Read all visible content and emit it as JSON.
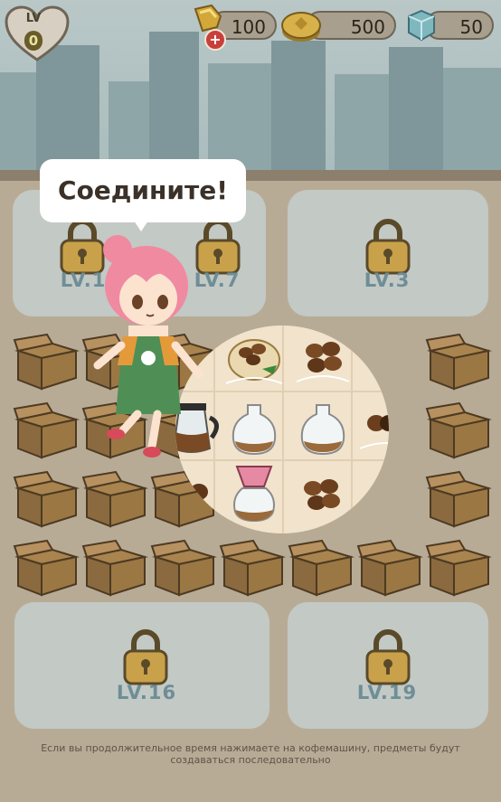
{
  "hud": {
    "level_label": "LV",
    "level_value": "0",
    "energy": "100",
    "coins": "500",
    "gems": "50",
    "icons": [
      "heart-icon",
      "energy-icon",
      "plus-icon",
      "coin-icon",
      "gem-icon"
    ]
  },
  "tutorial": {
    "bubble_text": "Соедините!"
  },
  "zones": {
    "top_left": "LV.1",
    "top_mid": "LV.7",
    "top_right": "LV.3",
    "bottom_left": "LV.16",
    "bottom_right": "LV.19"
  },
  "board": {
    "items": [
      "coffee-beans-sack",
      "coffee-beans",
      "coffee-pot",
      "empty-jar",
      "empty-jar",
      "coffee-beans",
      "coffee-beans",
      "pour-over-dripper",
      "coffee-beans"
    ]
  },
  "footer": {
    "hint": "Если вы продолжительное время нажимаете на кофемашину, предметы будут создаваться последовательно"
  },
  "colors": {
    "floor": "#b8ab95",
    "zone": "#c3cac6",
    "box": "#8a6a3e",
    "lock": "#c9a14a",
    "accent_red": "#c8403a"
  }
}
